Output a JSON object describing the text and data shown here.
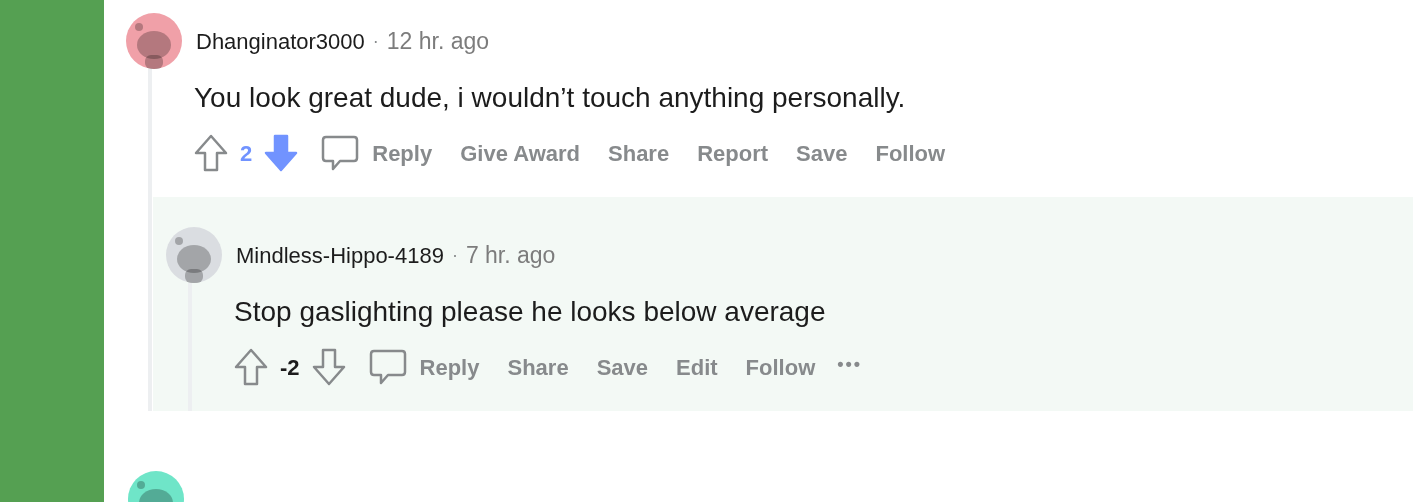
{
  "comments": [
    {
      "author": "Dhanginator3000",
      "separator": "·",
      "time": "12 hr. ago",
      "body": "You look great dude, i wouldn’t touch anything personally.",
      "score": "2",
      "upvoted": false,
      "downvoted": true,
      "color": "#f0a0a8",
      "highlighted": false,
      "actions": [
        "Reply",
        "Give Award",
        "Share",
        "Report",
        "Save",
        "Follow"
      ],
      "replies": [
        {
          "author": "Mindless-Hippo-4189",
          "separator": "·",
          "time": "7 hr. ago",
          "body": "Stop gaslighting please he looks below average",
          "score": "-2",
          "upvoted": false,
          "downvoted": false,
          "color": "#dadde1",
          "highlighted": true,
          "actions": [
            "Reply",
            "Share",
            "Save",
            "Edit",
            "Follow"
          ],
          "more": "•••"
        }
      ]
    },
    {
      "color": "#6fe5c8"
    }
  ]
}
